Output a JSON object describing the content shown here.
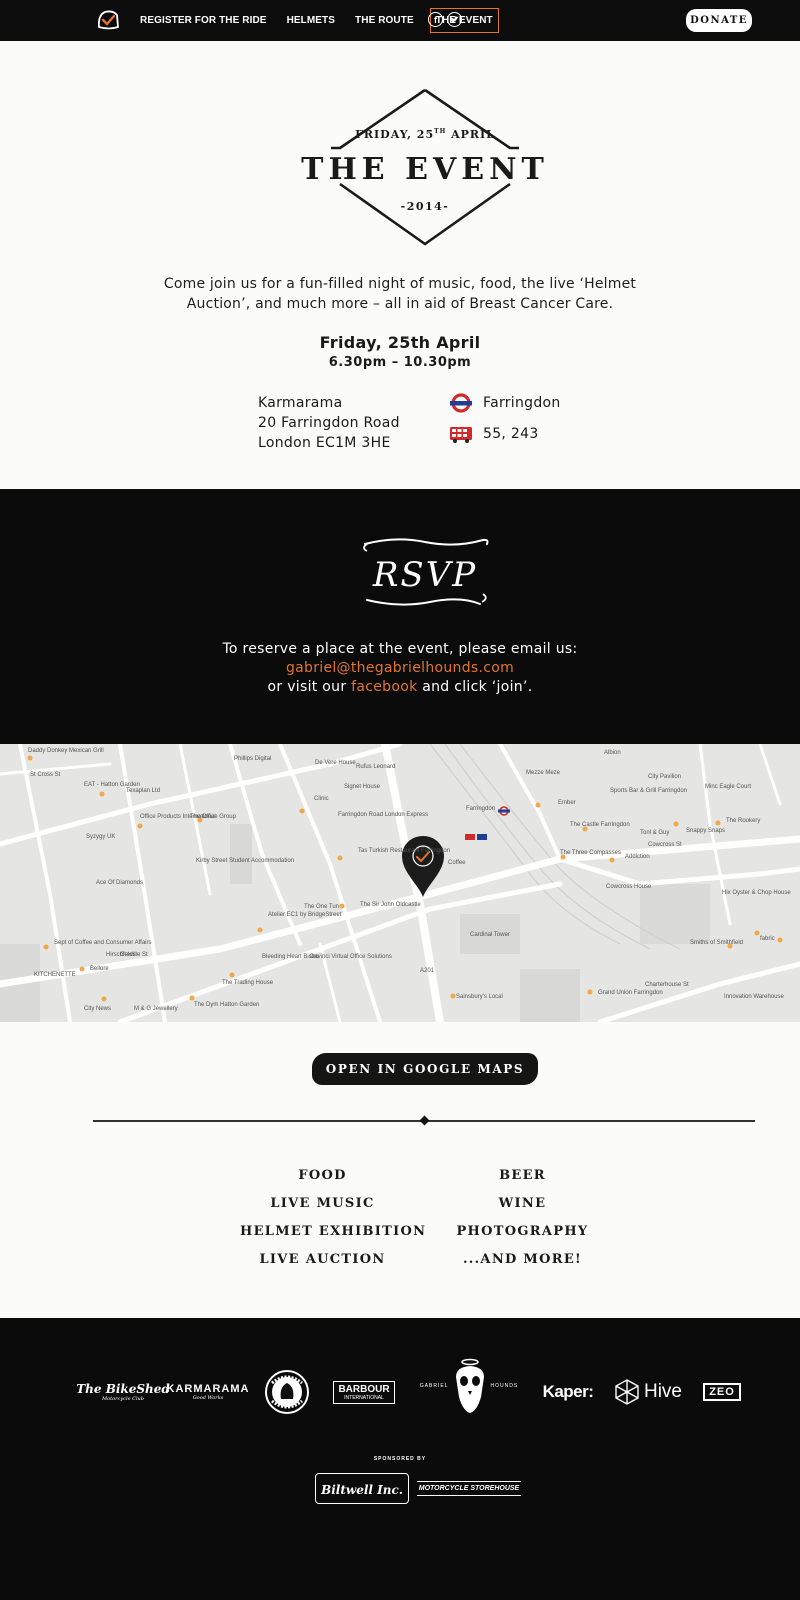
{
  "nav": {
    "links": [
      "REGISTER FOR THE RIDE",
      "HELMETS",
      "THE ROUTE",
      "THE EVENT"
    ],
    "active": "THE EVENT",
    "social": [
      {
        "icon": "facebook-icon",
        "glyph": "f"
      },
      {
        "icon": "twitter-icon",
        "glyph": "t"
      }
    ],
    "donate_label": "DONATE"
  },
  "badge": {
    "top_line": "FRIDAY, 25",
    "top_sup": "TH",
    "top_end": " APRIL",
    "title": "THE EVENT",
    "year": "-2014-"
  },
  "intro": "Come join us for a fun-filled night of music, food, the live ‘Helmet Auction’, and much more – all in aid of Breast Cancer Care.",
  "event": {
    "date": "Friday, 25th April",
    "time": "6.30pm – 10.30pm",
    "address": [
      "Karmarama",
      "20 Farringdon Road",
      "London EC1M 3HE"
    ],
    "tube": "Farringdon",
    "bus": "55, 243"
  },
  "rsvp": {
    "title": "RSVP",
    "line1": "To reserve a place at the event, please email us:",
    "email": "gabriel@thegabrielhounds.com",
    "line3_pre": "or visit our ",
    "facebook": "facebook",
    "line3_post": " and click ‘join’."
  },
  "map": {
    "labels": [
      "Daddy Donkey Mexican Grill",
      "EAT - Hatton Garden",
      "Texaplan Ltd",
      "Phillips Digital",
      "De Vere House",
      "Rufus Leonard",
      "Signet House",
      "Office Products International",
      "The Office Group",
      "Clinic",
      "Farringdon Road London Express",
      "Farringdon",
      "Ember",
      "Sports Bar & Grill Farringdon",
      "The Castle Farringdon",
      "Snappy Snaps",
      "The Rookery",
      "Tonl & Guy",
      "Syzygy UK",
      "Kirby Street Student Accommodation",
      "Tas Turkish Restaurant Farringdon",
      "Coffee",
      "The Three Compasses",
      "Addiction",
      "Cowcross St",
      "Ace Of Diamonds",
      "The One Tun",
      "The Sir John Oldcastle",
      "Atelier EC1 by BridgeStreet",
      "Hix Oyster & Chop House",
      "Sept of Coffee and Consumer Affairs",
      "Hirschfelds",
      "Bleeding Heart Bistro",
      "Davinci Virtual Office Solutions",
      "Smiths of Smithfield",
      "KITCHENETTE",
      "Bellore",
      "The Trading House",
      "Greville St",
      "Sainsbury's Local",
      "City News",
      "M & G Jewellery",
      "The Dym Hatton Garden",
      "Grand Union Farringdon",
      "Innovation Warehouse",
      "Charterhouse St",
      "Cardinal Tower",
      "A201",
      "fabric",
      "Minc Eagle Court",
      "St Cross St",
      "Mezze Meze",
      "City Pavilion",
      "Cowcross House",
      "Albion"
    ]
  },
  "gmaps_button": "OPEN IN GOOGLE MAPS",
  "features": {
    "left": [
      "FOOD",
      "LIVE MUSIC",
      "HELMET EXHIBITION",
      "LIVE AUCTION"
    ],
    "right": [
      "BEER",
      "WINE",
      "PHOTOGRAPHY",
      "...AND MORE!"
    ]
  },
  "sponsors": {
    "bikeshed_title": "The BikeShed",
    "bikeshed_sub": "Motorcycle Club",
    "karmarama": "KARMARAMA",
    "karmarama_sub": "Good Works",
    "barbour": "BARBOUR",
    "barbour_sub": "INTERNATIONAL",
    "gabriel_left": "GABRIEL",
    "gabriel_right": "HOUNDS",
    "kaper": "Kaper:",
    "hive": "Hive",
    "zeo": "ZEO",
    "sponsored_by": "SPONSORED BY",
    "biltwell": "Biltwell Inc.",
    "storehouse": "MOTORCYCLE STOREHOUSE"
  },
  "colors": {
    "accent": "#e2742e",
    "dark": "#0b0b0b",
    "paper": "#fbfbfa"
  }
}
